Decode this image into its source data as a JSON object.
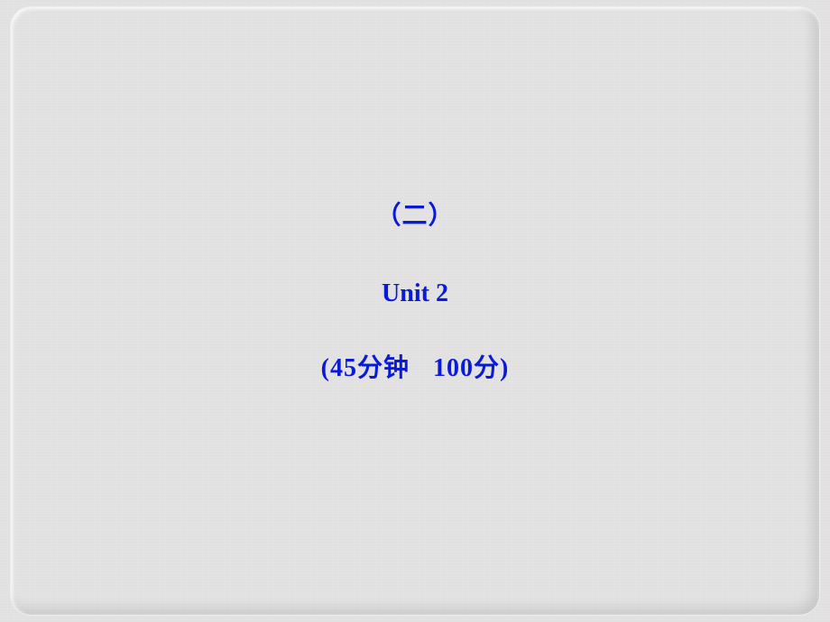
{
  "slide": {
    "line1": "（二）",
    "line2": "Unit  2",
    "line3_a": "(45分钟",
    "line3_b": "100分)"
  }
}
